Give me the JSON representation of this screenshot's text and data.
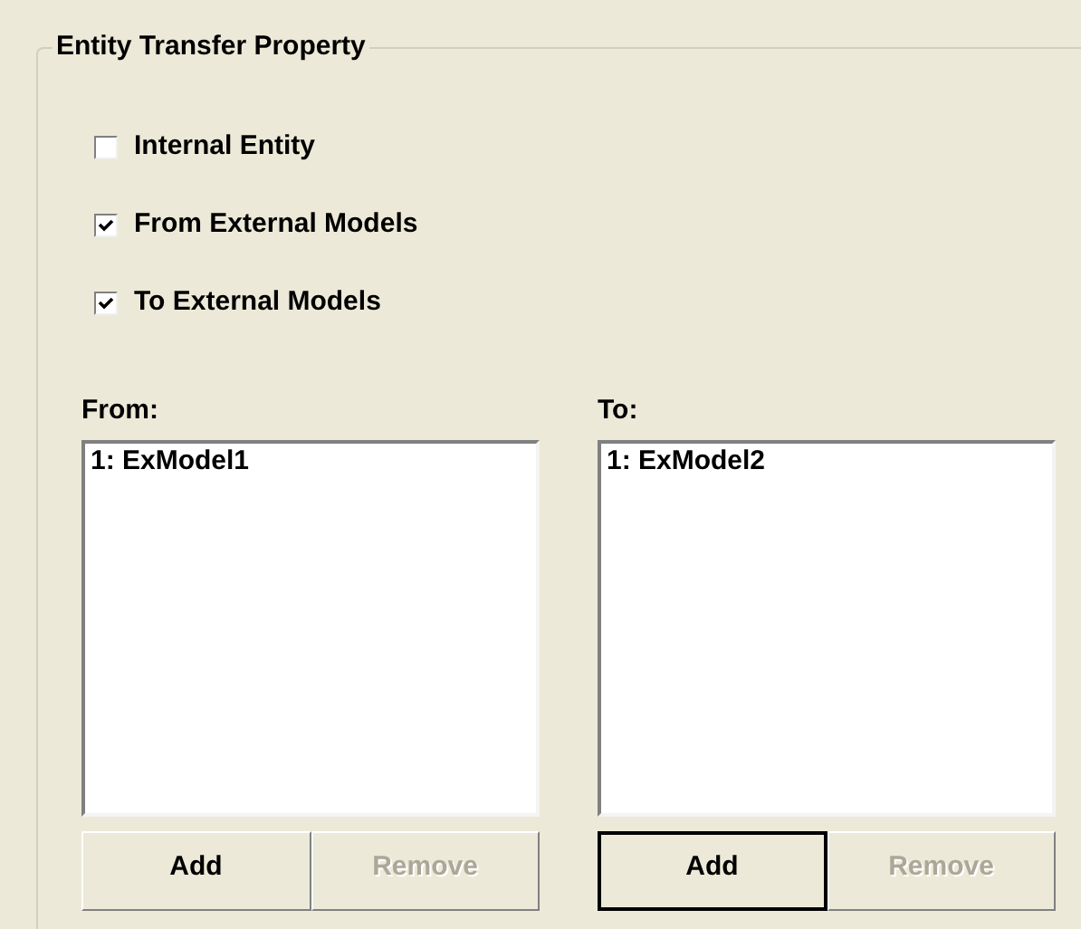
{
  "group": {
    "title": "Entity Transfer Property"
  },
  "checkboxes": [
    {
      "label": "Internal Entity",
      "checked": false
    },
    {
      "label": "From External Models",
      "checked": true
    },
    {
      "label": "To External Models",
      "checked": true
    }
  ],
  "lists": [
    {
      "label": "From:",
      "items": [
        "1: ExModel1"
      ],
      "buttons": [
        {
          "label": "Add",
          "disabled": false,
          "default": false
        },
        {
          "label": "Remove",
          "disabled": true,
          "default": false
        }
      ]
    },
    {
      "label": "To:",
      "items": [
        "1: ExModel2"
      ],
      "buttons": [
        {
          "label": "Add",
          "disabled": false,
          "default": true
        },
        {
          "label": "Remove",
          "disabled": true,
          "default": false
        }
      ]
    }
  ]
}
